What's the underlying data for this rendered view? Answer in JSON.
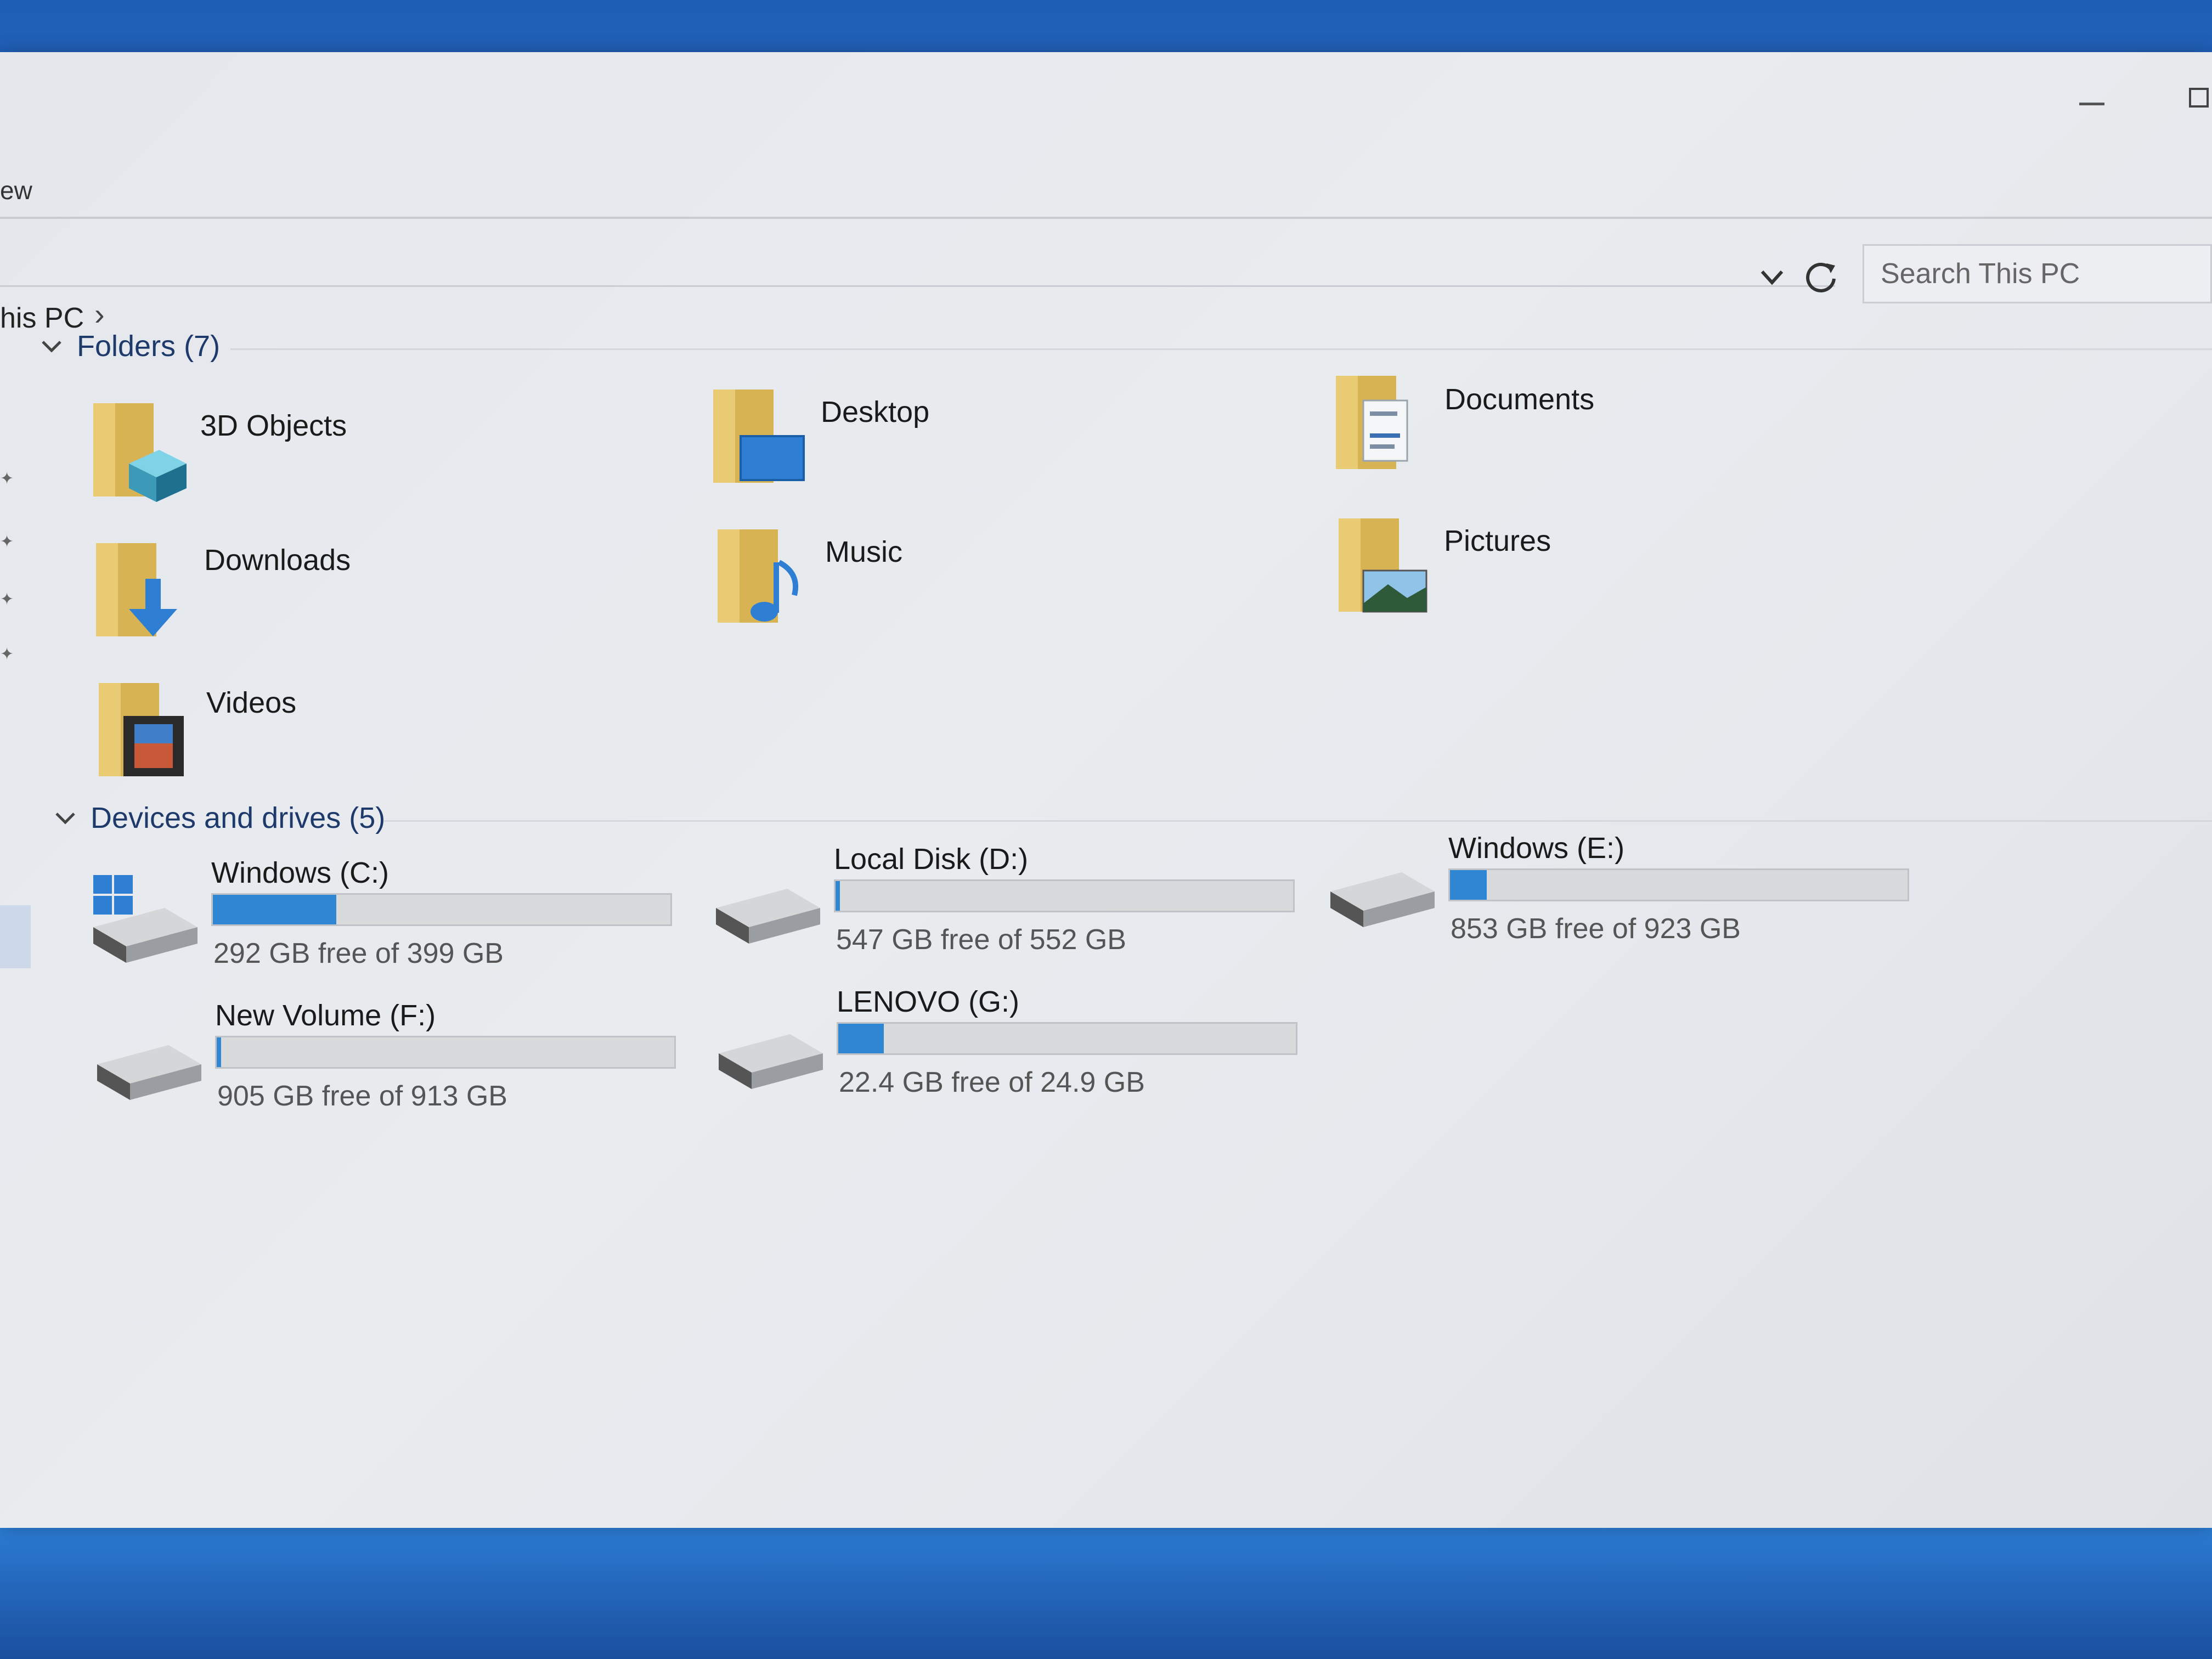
{
  "ribbon": {
    "view_tab": "ew"
  },
  "address": {
    "crumb": "his PC",
    "arrow": "›"
  },
  "search": {
    "placeholder": "Search This PC"
  },
  "folders_group": {
    "label": "Folders (7)",
    "items": [
      {
        "label": "3D Objects",
        "icon": "3d-objects-folder-icon"
      },
      {
        "label": "Desktop",
        "icon": "desktop-folder-icon"
      },
      {
        "label": "Documents",
        "icon": "documents-folder-icon"
      },
      {
        "label": "Downloads",
        "icon": "downloads-folder-icon"
      },
      {
        "label": "Music",
        "icon": "music-folder-icon"
      },
      {
        "label": "Pictures",
        "icon": "pictures-folder-icon"
      },
      {
        "label": "Videos",
        "icon": "videos-folder-icon"
      }
    ]
  },
  "drives_group": {
    "label": "Devices and drives (5)",
    "items": [
      {
        "name": "Windows (C:)",
        "free_text": "292 GB free of 399 GB",
        "used_fraction": 0.27,
        "os_drive": true
      },
      {
        "name": "Local Disk (D:)",
        "free_text": "547 GB free of 552 GB",
        "used_fraction": 0.01,
        "os_drive": false
      },
      {
        "name": "Windows (E:)",
        "free_text": "853 GB free of 923 GB",
        "used_fraction": 0.08,
        "os_drive": false
      },
      {
        "name": "New Volume (F:)",
        "free_text": "905 GB free of 913 GB",
        "used_fraction": 0.01,
        "os_drive": false
      },
      {
        "name": "LENOVO (G:)",
        "free_text": "22.4 GB free of 24.9 GB",
        "used_fraction": 0.1,
        "os_drive": false
      }
    ]
  },
  "colors": {
    "bar_fill": "#2f86d2",
    "folder": "#e8c46a",
    "header_text": "#1e3a6b"
  }
}
